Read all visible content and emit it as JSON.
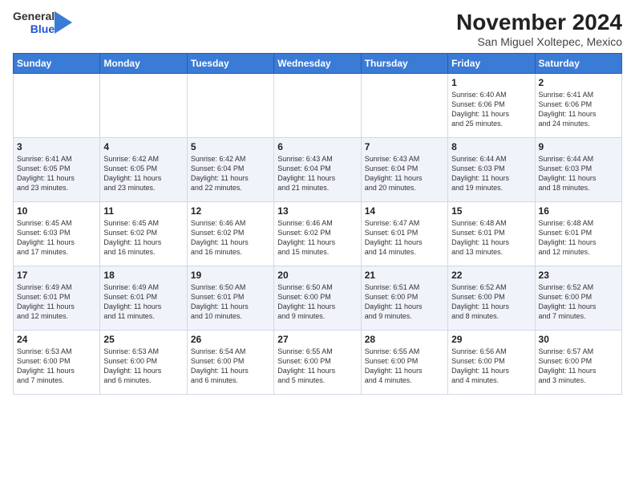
{
  "logo": {
    "general": "General",
    "blue": "Blue"
  },
  "title": "November 2024",
  "subtitle": "San Miguel Xoltepec, Mexico",
  "days_of_week": [
    "Sunday",
    "Monday",
    "Tuesday",
    "Wednesday",
    "Thursday",
    "Friday",
    "Saturday"
  ],
  "weeks": [
    [
      {
        "day": "",
        "info": ""
      },
      {
        "day": "",
        "info": ""
      },
      {
        "day": "",
        "info": ""
      },
      {
        "day": "",
        "info": ""
      },
      {
        "day": "",
        "info": ""
      },
      {
        "day": "1",
        "info": "Sunrise: 6:40 AM\nSunset: 6:06 PM\nDaylight: 11 hours\nand 25 minutes."
      },
      {
        "day": "2",
        "info": "Sunrise: 6:41 AM\nSunset: 6:06 PM\nDaylight: 11 hours\nand 24 minutes."
      }
    ],
    [
      {
        "day": "3",
        "info": "Sunrise: 6:41 AM\nSunset: 6:05 PM\nDaylight: 11 hours\nand 23 minutes."
      },
      {
        "day": "4",
        "info": "Sunrise: 6:42 AM\nSunset: 6:05 PM\nDaylight: 11 hours\nand 23 minutes."
      },
      {
        "day": "5",
        "info": "Sunrise: 6:42 AM\nSunset: 6:04 PM\nDaylight: 11 hours\nand 22 minutes."
      },
      {
        "day": "6",
        "info": "Sunrise: 6:43 AM\nSunset: 6:04 PM\nDaylight: 11 hours\nand 21 minutes."
      },
      {
        "day": "7",
        "info": "Sunrise: 6:43 AM\nSunset: 6:04 PM\nDaylight: 11 hours\nand 20 minutes."
      },
      {
        "day": "8",
        "info": "Sunrise: 6:44 AM\nSunset: 6:03 PM\nDaylight: 11 hours\nand 19 minutes."
      },
      {
        "day": "9",
        "info": "Sunrise: 6:44 AM\nSunset: 6:03 PM\nDaylight: 11 hours\nand 18 minutes."
      }
    ],
    [
      {
        "day": "10",
        "info": "Sunrise: 6:45 AM\nSunset: 6:03 PM\nDaylight: 11 hours\nand 17 minutes."
      },
      {
        "day": "11",
        "info": "Sunrise: 6:45 AM\nSunset: 6:02 PM\nDaylight: 11 hours\nand 16 minutes."
      },
      {
        "day": "12",
        "info": "Sunrise: 6:46 AM\nSunset: 6:02 PM\nDaylight: 11 hours\nand 16 minutes."
      },
      {
        "day": "13",
        "info": "Sunrise: 6:46 AM\nSunset: 6:02 PM\nDaylight: 11 hours\nand 15 minutes."
      },
      {
        "day": "14",
        "info": "Sunrise: 6:47 AM\nSunset: 6:01 PM\nDaylight: 11 hours\nand 14 minutes."
      },
      {
        "day": "15",
        "info": "Sunrise: 6:48 AM\nSunset: 6:01 PM\nDaylight: 11 hours\nand 13 minutes."
      },
      {
        "day": "16",
        "info": "Sunrise: 6:48 AM\nSunset: 6:01 PM\nDaylight: 11 hours\nand 12 minutes."
      }
    ],
    [
      {
        "day": "17",
        "info": "Sunrise: 6:49 AM\nSunset: 6:01 PM\nDaylight: 11 hours\nand 12 minutes."
      },
      {
        "day": "18",
        "info": "Sunrise: 6:49 AM\nSunset: 6:01 PM\nDaylight: 11 hours\nand 11 minutes."
      },
      {
        "day": "19",
        "info": "Sunrise: 6:50 AM\nSunset: 6:01 PM\nDaylight: 11 hours\nand 10 minutes."
      },
      {
        "day": "20",
        "info": "Sunrise: 6:50 AM\nSunset: 6:00 PM\nDaylight: 11 hours\nand 9 minutes."
      },
      {
        "day": "21",
        "info": "Sunrise: 6:51 AM\nSunset: 6:00 PM\nDaylight: 11 hours\nand 9 minutes."
      },
      {
        "day": "22",
        "info": "Sunrise: 6:52 AM\nSunset: 6:00 PM\nDaylight: 11 hours\nand 8 minutes."
      },
      {
        "day": "23",
        "info": "Sunrise: 6:52 AM\nSunset: 6:00 PM\nDaylight: 11 hours\nand 7 minutes."
      }
    ],
    [
      {
        "day": "24",
        "info": "Sunrise: 6:53 AM\nSunset: 6:00 PM\nDaylight: 11 hours\nand 7 minutes."
      },
      {
        "day": "25",
        "info": "Sunrise: 6:53 AM\nSunset: 6:00 PM\nDaylight: 11 hours\nand 6 minutes."
      },
      {
        "day": "26",
        "info": "Sunrise: 6:54 AM\nSunset: 6:00 PM\nDaylight: 11 hours\nand 6 minutes."
      },
      {
        "day": "27",
        "info": "Sunrise: 6:55 AM\nSunset: 6:00 PM\nDaylight: 11 hours\nand 5 minutes."
      },
      {
        "day": "28",
        "info": "Sunrise: 6:55 AM\nSunset: 6:00 PM\nDaylight: 11 hours\nand 4 minutes."
      },
      {
        "day": "29",
        "info": "Sunrise: 6:56 AM\nSunset: 6:00 PM\nDaylight: 11 hours\nand 4 minutes."
      },
      {
        "day": "30",
        "info": "Sunrise: 6:57 AM\nSunset: 6:00 PM\nDaylight: 11 hours\nand 3 minutes."
      }
    ]
  ]
}
